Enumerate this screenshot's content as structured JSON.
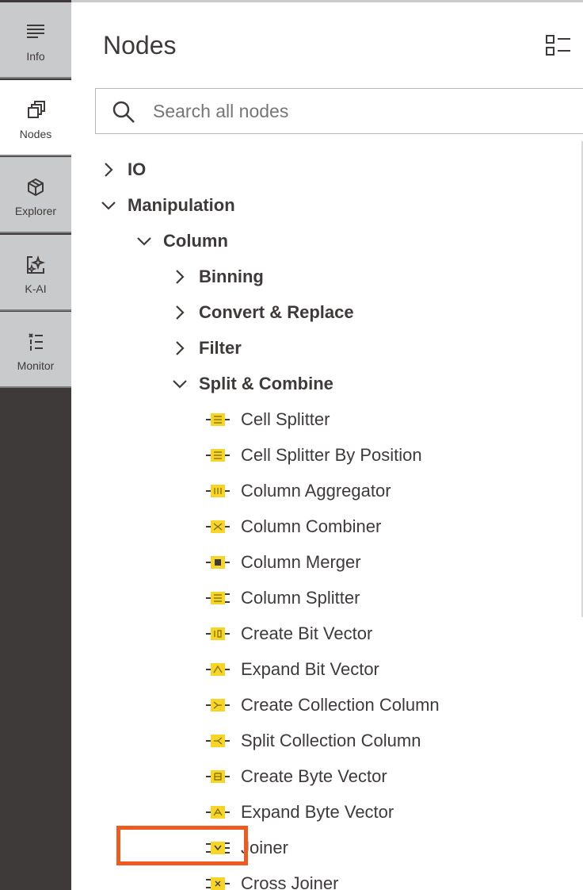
{
  "sidebar": {
    "tabs": [
      {
        "label": "Info",
        "icon": "info-lines-icon"
      },
      {
        "label": "Nodes",
        "icon": "nodes-stack-icon"
      },
      {
        "label": "Explorer",
        "icon": "explorer-cube-icon"
      },
      {
        "label": "K-AI",
        "icon": "k-ai-sparkle-icon"
      },
      {
        "label": "Monitor",
        "icon": "monitor-list-icon"
      }
    ],
    "active_tab": "Nodes"
  },
  "panel": {
    "title": "Nodes",
    "view_toggle_icon": "list-view-icon"
  },
  "search": {
    "placeholder": "Search all nodes",
    "value": ""
  },
  "tree": {
    "categories": {
      "io": {
        "label": "IO",
        "expanded": false
      },
      "manipulation": {
        "label": "Manipulation",
        "expanded": true
      },
      "column": {
        "label": "Column",
        "expanded": true
      },
      "binning": {
        "label": "Binning",
        "expanded": false
      },
      "convert_replace": {
        "label": "Convert & Replace",
        "expanded": false
      },
      "filter": {
        "label": "Filter",
        "expanded": false
      },
      "split_combine": {
        "label": "Split & Combine",
        "expanded": true
      }
    },
    "nodes": [
      {
        "label": "Cell Splitter"
      },
      {
        "label": "Cell Splitter By Position"
      },
      {
        "label": "Column Aggregator"
      },
      {
        "label": "Column Combiner"
      },
      {
        "label": "Column Merger"
      },
      {
        "label": "Column Splitter"
      },
      {
        "label": "Create Bit Vector"
      },
      {
        "label": "Expand Bit Vector"
      },
      {
        "label": "Create Collection Column"
      },
      {
        "label": "Split Collection Column"
      },
      {
        "label": "Create Byte Vector"
      },
      {
        "label": "Expand Byte Vector"
      },
      {
        "label": "Joiner",
        "highlighted": true
      },
      {
        "label": "Cross Joiner"
      }
    ]
  },
  "colors": {
    "rail_dark": "#3e3a39",
    "rail_tab": "#c9cacc",
    "node_icon": "#f7d528",
    "highlight": "#ee5a1f",
    "text": "#3e3a39"
  }
}
